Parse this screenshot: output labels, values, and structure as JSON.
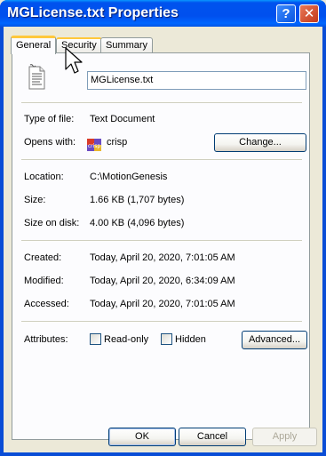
{
  "window": {
    "title": "MGLicense.txt Properties",
    "help_glyph": "?",
    "close_glyph": "✕"
  },
  "tabs": [
    {
      "label": "General"
    },
    {
      "label": "Security"
    },
    {
      "label": "Summary"
    }
  ],
  "general": {
    "filename": "MGLicense.txt",
    "type_label": "Type of file:",
    "type_value": "Text Document",
    "opens_label": "Opens with:",
    "opens_value": "crisp",
    "opens_icon_text": "crisp",
    "change_button": "Change...",
    "location_label": "Location:",
    "location_value": "C:\\MotionGenesis",
    "size_label": "Size:",
    "size_value": "1.66 KB (1,707 bytes)",
    "size_disk_label": "Size on disk:",
    "size_disk_value": "4.00 KB (4,096 bytes)",
    "created_label": "Created:",
    "created_value": "Today, April 20, 2020, 7:01:05 AM",
    "modified_label": "Modified:",
    "modified_value": "Today, April 20, 2020, 6:34:09 AM",
    "accessed_label": "Accessed:",
    "accessed_value": "Today, April 20, 2020, 7:01:05 AM",
    "attributes_label": "Attributes:",
    "readonly_label": "Read-only",
    "readonly_checked": false,
    "hidden_label": "Hidden",
    "hidden_checked": false,
    "advanced_button": "Advanced..."
  },
  "footer": {
    "ok": "OK",
    "cancel": "Cancel",
    "apply": "Apply"
  },
  "colors": {
    "titlebar": "#0054e3",
    "tab_highlight": "#ffc83c",
    "face": "#ece9d8"
  }
}
